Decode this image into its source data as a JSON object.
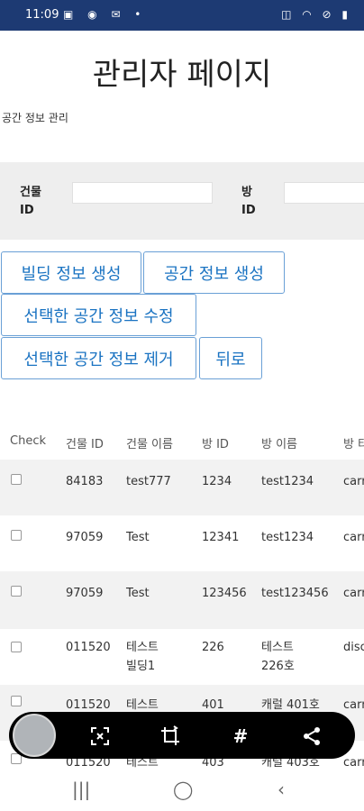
{
  "status_bar": {
    "time": "11:09"
  },
  "page_title": "관리자 페이지",
  "section_title": "공간 정보 관리",
  "filters": {
    "building_id_label": "건물\nID",
    "room_id_label": "방\nID",
    "building_id_value": "",
    "room_id_value": ""
  },
  "buttons": {
    "create_building": "빌딩 정보 생성",
    "create_space": "공간 정보 생성",
    "edit_space": "선택한 공간 정보 수정",
    "delete_space": "선택한 공간 정보 제거",
    "back": "뒤로"
  },
  "table": {
    "headers": [
      "Check",
      "건물 ID",
      "건물 이름",
      "방 ID",
      "방 이름",
      "방 타"
    ],
    "rows": [
      {
        "building_id": "84183",
        "building_name": "test777",
        "room_id": "1234",
        "room_name": "test1234",
        "room_type": "carr"
      },
      {
        "building_id": "97059",
        "building_name": "Test",
        "room_id": "12341",
        "room_name": "test1234",
        "room_type": "carr"
      },
      {
        "building_id": "97059",
        "building_name": "Test",
        "room_id": "123456",
        "room_name": "test123456",
        "room_type": "carr"
      },
      {
        "building_id": "011520",
        "building_name": "테스트\n빌딩1",
        "room_id": "226",
        "room_name": "테스트\n226호",
        "room_type": "disc"
      },
      {
        "building_id": "011520",
        "building_name": "테스트",
        "room_id": "401",
        "room_name": "캐럴 401호",
        "room_type": "carr"
      },
      {
        "building_id": "011520",
        "building_name": "테스트",
        "room_id": "403",
        "room_name": "캐럴 403호",
        "room_type": "carr"
      }
    ]
  },
  "toolbar": {
    "icons": [
      "scan-icon",
      "crop-rotate-icon",
      "hashtag-icon",
      "share-icon"
    ],
    "hashtag_glyph": "#"
  },
  "colors": {
    "status_bar": "#1d3a73",
    "button_text": "#1a73c2",
    "button_border": "#6aa0d6",
    "filter_bg": "#eeeeee"
  }
}
